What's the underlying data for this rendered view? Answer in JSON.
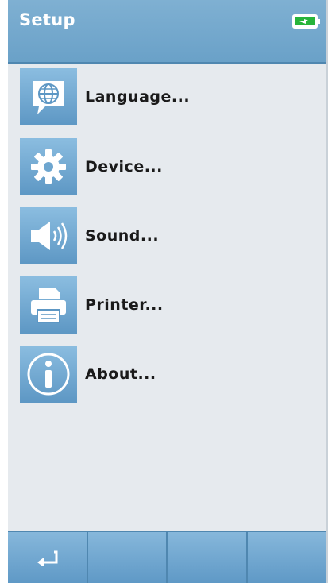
{
  "header": {
    "title": "Setup",
    "battery_icon": "battery-charging-icon"
  },
  "menu": {
    "items": [
      {
        "label": "Language...",
        "icon": "globe-speech-bubble-icon"
      },
      {
        "label": "Device...",
        "icon": "gear-icon"
      },
      {
        "label": "Sound...",
        "icon": "speaker-icon"
      },
      {
        "label": "Printer...",
        "icon": "printer-icon"
      },
      {
        "label": "About...",
        "icon": "info-icon"
      }
    ]
  },
  "footer": {
    "buttons": [
      {
        "icon": "back-arrow-icon"
      },
      {
        "icon": ""
      },
      {
        "icon": ""
      },
      {
        "icon": ""
      }
    ]
  },
  "colors": {
    "header_bg": "#6aa1c8",
    "screen_bg": "#e6eaee",
    "icon_tile": "#6ea6cf",
    "battery_fill": "#27b43a"
  }
}
